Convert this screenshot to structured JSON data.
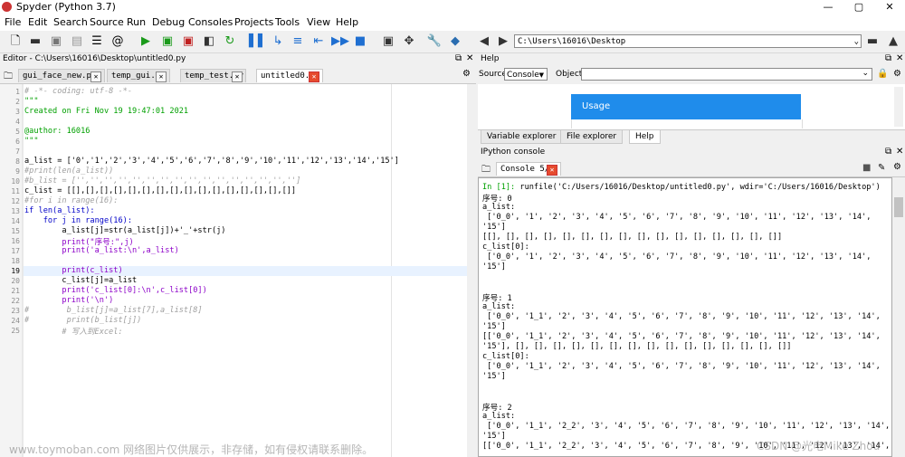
{
  "window": {
    "title": "Spyder (Python 3.7)",
    "controls": [
      "—",
      "▢",
      "✕"
    ]
  },
  "menu": [
    "File",
    "Edit",
    "Search",
    "Source",
    "Run",
    "Debug",
    "Consoles",
    "Projects",
    "Tools",
    "View",
    "Help"
  ],
  "toolbar": {
    "path": "C:\\Users\\16016\\Desktop",
    "icons": [
      "new-file-icon",
      "open-folder-icon",
      "save-icon",
      "save-all-icon",
      "list-icon",
      "at-icon",
      "run-icon",
      "run-cell-icon",
      "run-cell-advance-icon",
      "run-selection-icon",
      "rerun-icon",
      "debug-icon",
      "step-icon",
      "step-into-icon",
      "step-return-icon",
      "continue-icon",
      "stop-icon",
      "maximize-pane-icon",
      "fullscreen-icon",
      "wrench-icon",
      "python-icon",
      "back-icon",
      "forward-icon",
      "browse-folder-icon",
      "parent-dir-icon"
    ]
  },
  "editor": {
    "header": "Editor - C:\\Users\\16016\\Desktop\\untitled0.py",
    "tabs": [
      {
        "label": "gui_face_new.py"
      },
      {
        "label": "temp_gui.py"
      },
      {
        "label": "temp_test.py"
      },
      {
        "label": "untitled0.py"
      }
    ],
    "line_numbers": [
      "1",
      "2",
      "3",
      "4",
      "5",
      "6",
      "7",
      "8",
      "9",
      "10",
      "11",
      "12",
      "13",
      "14",
      "15",
      "16",
      "17",
      "18",
      "19",
      "20",
      "21",
      "22",
      "23",
      "24",
      "25"
    ],
    "lines": [
      "# -*- coding: utf-8 -*-",
      "\"\"\"",
      "Created on Fri Nov 19 19:47:01 2021",
      "",
      "@author: 16016",
      "\"\"\"",
      "",
      "a_list = ['0','1','2','3','4','5','6','7','8','9','10','11','12','13','14','15']",
      "#print(len(a_list))",
      "#b_list = ['','','','','','','','','','','','','','','','']",
      "c_list = [[],[],[],[],[],[],[],[],[],[],[],[],[],[],[],[]]",
      "#for i in range(16):",
      "if len(a_list):",
      "    for j in range(16):",
      "        a_list[j]=str(a_list[j])+'_'+str(j)",
      "        print(\"序号:\",j)",
      "        print('a_list:\\n',a_list)",
      "",
      "        print(c_list)",
      "        c_list[j]=a_list",
      "        print('c_list[0]:\\n',c_list[0])",
      "        print('\\n')",
      "#        b_list[j]=a_list[7],a_list[8]",
      "#        print(b_list[j])",
      "        # 写入到Excel:"
    ]
  },
  "help": {
    "header": "Help",
    "source_label": "Source",
    "source_value": "Console",
    "object_label": "Object",
    "usage_title": "Usage",
    "tabs": [
      "Variable explorer",
      "File explorer",
      "Help"
    ]
  },
  "console": {
    "header": "IPython console",
    "tab": "Console 5/A",
    "lines": [
      "In [1]: runfile('C:/Users/16016/Desktop/untitled0.py', wdir='C:/Users/16016/Desktop')",
      "序号: 0",
      "a_list:",
      " ['0_0', '1', '2', '3', '4', '5', '6', '7', '8', '9', '10', '11', '12', '13', '14',",
      "'15']",
      "[[], [], [], [], [], [], [], [], [], [], [], [], [], [], [], []]",
      "c_list[0]:",
      " ['0_0', '1', '2', '3', '4', '5', '6', '7', '8', '9', '10', '11', '12', '13', '14',",
      "'15']",
      "",
      "",
      "序号: 1",
      "a_list:",
      " ['0_0', '1_1', '2', '3', '4', '5', '6', '7', '8', '9', '10', '11', '12', '13', '14',",
      "'15']",
      "[['0_0', '1_1', '2', '3', '4', '5', '6', '7', '8', '9', '10', '11', '12', '13', '14',",
      "'15'], [], [], [], [], [], [], [], [], [], [], [], [], [], [], []]",
      "c_list[0]:",
      " ['0_0', '1_1', '2', '3', '4', '5', '6', '7', '8', '9', '10', '11', '12', '13', '14',",
      "'15']",
      "",
      "",
      "序号: 2",
      "a_list:",
      " ['0_0', '1_1', '2_2', '3', '4', '5', '6', '7', '8', '9', '10', '11', '12', '13', '14',",
      "'15']",
      "[['0_0', '1_1', '2_2', '3', '4', '5', '6', '7', '8', '9', '10', '11', '12', '13', '14',"
    ]
  },
  "watermarks": {
    "left": "www.toymoban.com 网络图片仅供展示，非存储，如有侵权请联系删除。",
    "right": "CSDN @光电Mike Zhou"
  }
}
